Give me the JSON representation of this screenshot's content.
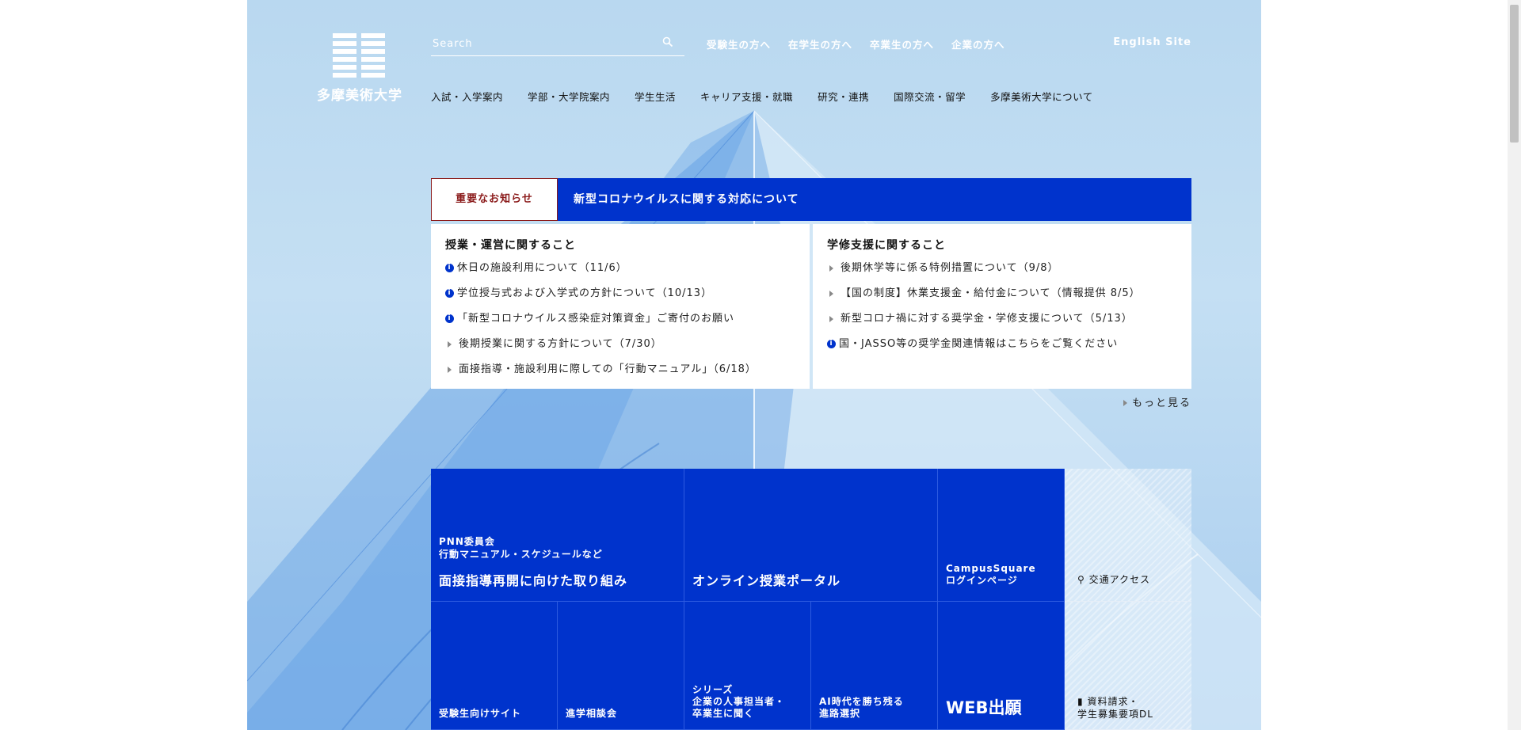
{
  "logo": {
    "name": "多摩美術大学"
  },
  "search": {
    "placeholder": "Search"
  },
  "top_nav": [
    "受験生の方へ",
    "在学生の方へ",
    "卒業生の方へ",
    "企業の方へ"
  ],
  "english_site": "English Site",
  "main_nav": [
    "入試・入学案内",
    "学部・大学院案内",
    "学生生活",
    "キャリア支援・就職",
    "研究・連携",
    "国際交流・留学",
    "多摩美術大学について"
  ],
  "notice": {
    "tab_label": "重要なお知らせ",
    "headline": "新型コロナウイルスに関する対応について",
    "left": {
      "title": "授業・運営に関すること",
      "items": [
        {
          "text": "休日の施設利用について（11/6）",
          "icon": "info"
        },
        {
          "text": "学位授与式および入学式の方針について（10/13）",
          "icon": "info"
        },
        {
          "text": "「新型コロナウイルス感染症対策資金」ご寄付のお願い",
          "icon": "info"
        },
        {
          "text": "後期授業に関する方針について（7/30）",
          "icon": "arrow"
        },
        {
          "text": "面接指導・施設利用に際しての「行動マニュアル」（6/18）",
          "icon": "arrow"
        }
      ]
    },
    "right": {
      "title": "学修支援に関すること",
      "items": [
        {
          "text": "後期休学等に係る特例措置について（9/8）",
          "icon": "arrow"
        },
        {
          "text": "【国の制度】休業支援金・給付金について（情報提供 8/5）",
          "icon": "arrow"
        },
        {
          "text": "新型コロナ禍に対する奨学金・学修支援について（5/13）",
          "icon": "arrow"
        },
        {
          "text": "国・JASSO等の奨学金関連情報はこちらをご覧ください",
          "icon": "info"
        }
      ]
    },
    "more": "もっと見る"
  },
  "tiles": {
    "t1": {
      "small1": "PNN委員会",
      "small2": "行動マニュアル・スケジュールなど",
      "big": "面接指導再開に向けた取り組み"
    },
    "t2": {
      "big": "オンライン授業ポータル"
    },
    "t3": {
      "small1": "CampusSquare",
      "small2": "ログインページ"
    },
    "t4": {
      "label": "交通アクセス"
    },
    "t5": {
      "small1": "受験生向けサイト"
    },
    "t6": {
      "small1": "進学相談会"
    },
    "t7": {
      "small1": "シリーズ",
      "small2": "企業の人事担当者・",
      "small3": "卒業生に聞く"
    },
    "t8": {
      "small1": "AI時代を勝ち残る",
      "small2": "進路選択"
    },
    "t9": {
      "big": "WEB出願"
    },
    "t10": {
      "label1": "資料請求・",
      "label2": "学生募集要項DL"
    }
  },
  "colors": {
    "brand_blue": "#0033cc",
    "notice_red": "#8b1b1b",
    "sky": "#b9d8f0"
  }
}
